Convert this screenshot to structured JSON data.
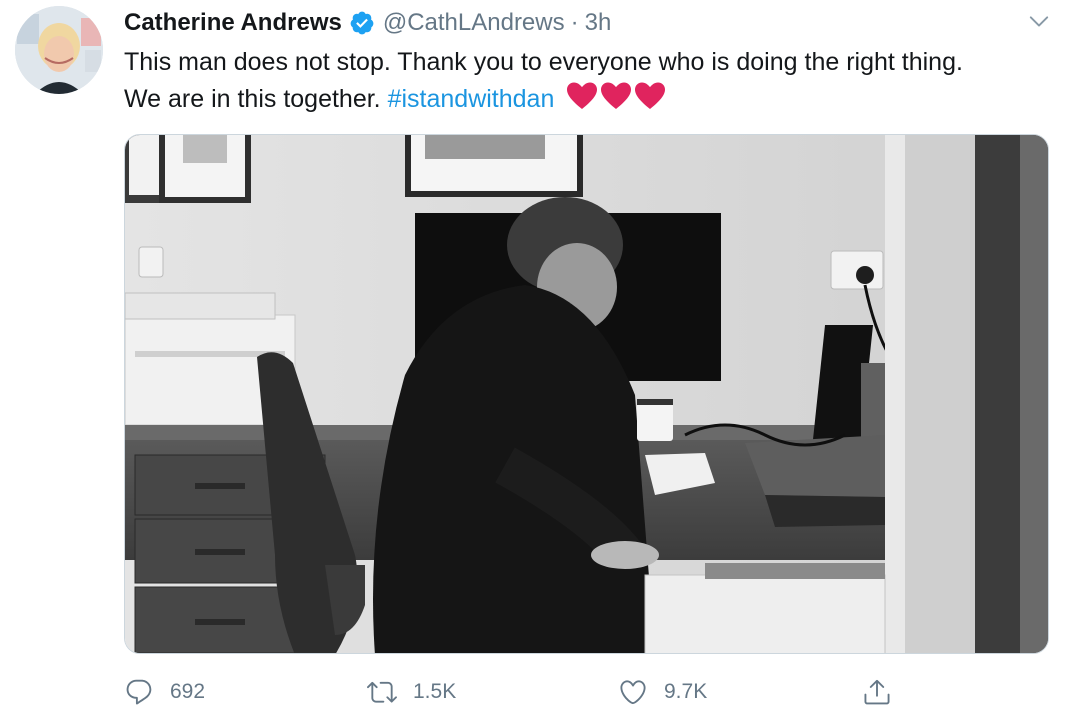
{
  "tweet": {
    "author": {
      "name": "Catherine Andrews",
      "handle": "@CathLAndrews",
      "separator": "·",
      "time": "3h",
      "verified": true
    },
    "text_line1": "This man does not stop. Thank you to everyone who is doing the right thing.",
    "text_line2_prefix": "We are in this together. ",
    "hashtag": "#istandwithdan",
    "emoji": [
      "red-heart",
      "red-heart",
      "red-heart"
    ],
    "media": {
      "type": "photo",
      "grayscale": true
    },
    "actions": {
      "reply_count": "692",
      "retweet_count": "1.5K",
      "like_count": "9.7K"
    }
  },
  "colors": {
    "link": "#1b95e0",
    "verified": "#1da1f2",
    "muted": "#657786",
    "heart": "#e0245e"
  },
  "icons": [
    "verified-badge-icon",
    "chevron-down-icon",
    "reply-icon",
    "retweet-icon",
    "like-icon",
    "share-icon"
  ]
}
